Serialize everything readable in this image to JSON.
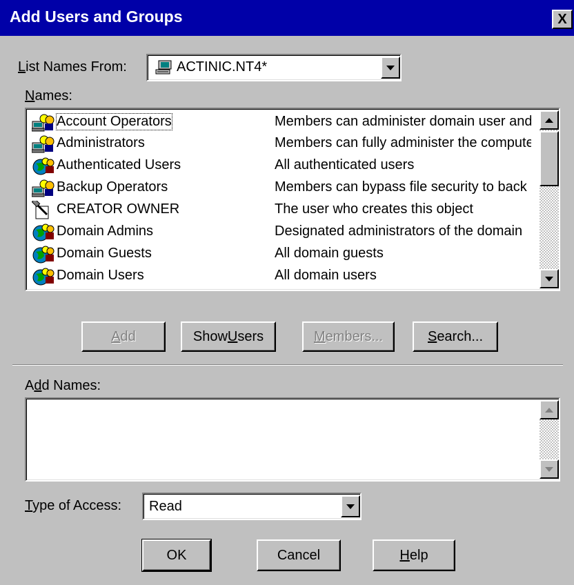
{
  "window": {
    "title": "Add Users and Groups",
    "close_label": "X"
  },
  "list_names_from": {
    "label_ul": "L",
    "label_rest": "ist Names From:",
    "value": "ACTINIC.NT4*",
    "icon": "computer-icon"
  },
  "names": {
    "label_ul": "N",
    "label_rest": "ames:",
    "rows": [
      {
        "name": "Account Operators",
        "description": "Members can administer domain user and",
        "icon": "local-group-icon"
      },
      {
        "name": "Administrators",
        "description": "Members can fully administer the computer",
        "icon": "local-group-icon"
      },
      {
        "name": "Authenticated Users",
        "description": "All authenticated users",
        "icon": "global-group-icon"
      },
      {
        "name": "Backup Operators",
        "description": "Members can bypass file security to back",
        "icon": "local-group-icon"
      },
      {
        "name": "CREATOR OWNER",
        "description": "The user who creates this object",
        "icon": "creator-owner-icon"
      },
      {
        "name": "Domain Admins",
        "description": "Designated administrators of the domain",
        "icon": "global-group-icon"
      },
      {
        "name": "Domain Guests",
        "description": "All domain guests",
        "icon": "global-group-icon"
      },
      {
        "name": "Domain Users",
        "description": "All domain users",
        "icon": "global-group-icon"
      }
    ]
  },
  "buttons": {
    "add_ul": "A",
    "add_rest": "dd",
    "show_users_pre": "Show ",
    "show_users_ul": "U",
    "show_users_rest": "sers",
    "members_ul": "M",
    "members_rest": "embers...",
    "search_ul": "S",
    "search_rest": "earch..."
  },
  "add_names": {
    "label_pre": "A",
    "label_ul": "d",
    "label_rest": "d Names:",
    "value": ""
  },
  "type_of_access": {
    "label_ul": "T",
    "label_rest": "ype of Access:",
    "value": "Read"
  },
  "footer": {
    "ok": "OK",
    "cancel": "Cancel",
    "help_ul": "H",
    "help_rest": "elp"
  }
}
